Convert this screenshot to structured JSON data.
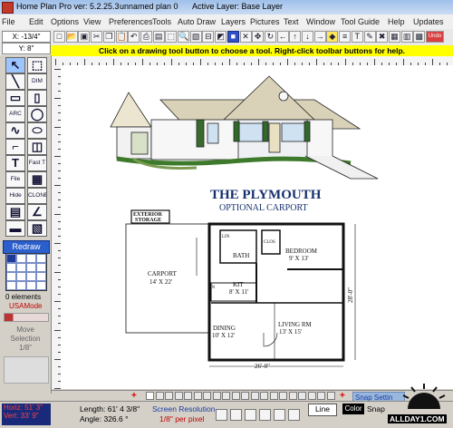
{
  "window": {
    "title": "Home Plan Pro ver: 5.2.25.3",
    "plan_name": "unnamed plan 0",
    "active_layer": "Active Layer: Base Layer"
  },
  "menu": [
    "File",
    "Edit",
    "Options",
    "View",
    "Preferences",
    "Tools",
    "Auto Draw",
    "Layers",
    "Pictures",
    "Text",
    "Window",
    "Tool Guide",
    "Help",
    "Updates"
  ],
  "coords": {
    "x": "X: -13/4\"",
    "y": "Y: 8\""
  },
  "toolbar": {
    "buttons": [
      {
        "name": "new-icon",
        "glyph": "□"
      },
      {
        "name": "open-icon",
        "glyph": "📂"
      },
      {
        "name": "save-icon",
        "glyph": "▣"
      },
      {
        "name": "cut-icon",
        "glyph": "✂"
      },
      {
        "name": "copy-icon",
        "glyph": "❐"
      },
      {
        "name": "paste-icon",
        "glyph": "📋"
      },
      {
        "name": "undo-icon",
        "glyph": "↶"
      },
      {
        "name": "print-icon",
        "glyph": "⎙"
      },
      {
        "name": "save-disk-icon",
        "glyph": "▤"
      },
      {
        "name": "select-icon",
        "glyph": "⬚"
      },
      {
        "name": "zoom-in-icon",
        "glyph": "🔍"
      },
      {
        "name": "zoom-icon",
        "glyph": "▧"
      },
      {
        "name": "zoom-out-icon",
        "glyph": "⊟"
      },
      {
        "name": "mirror-icon",
        "glyph": "◩"
      },
      {
        "name": "blue-square-icon",
        "glyph": "■"
      },
      {
        "name": "cross-icon",
        "glyph": "✕"
      },
      {
        "name": "move-icon",
        "glyph": "✥"
      },
      {
        "name": "rotate-icon",
        "glyph": "↻"
      },
      {
        "name": "left-arrow-icon",
        "glyph": "←"
      },
      {
        "name": "up-arrow-icon",
        "glyph": "↑"
      },
      {
        "name": "down-arrow-icon",
        "glyph": "↓"
      },
      {
        "name": "right-arrow-icon",
        "glyph": "→"
      },
      {
        "name": "yellow-icon",
        "glyph": "◆"
      },
      {
        "name": "align-icon",
        "glyph": "≡"
      },
      {
        "name": "text-icon",
        "glyph": "T"
      },
      {
        "name": "pencil-icon",
        "glyph": "✎"
      },
      {
        "name": "x-close-icon",
        "glyph": "✖"
      },
      {
        "name": "view-icon",
        "glyph": "▦"
      },
      {
        "name": "wall-icon",
        "glyph": "▥"
      },
      {
        "name": "fill-icon",
        "glyph": "▩"
      },
      {
        "name": "undo-badge-icon",
        "glyph": "Undo"
      }
    ],
    "colors": {
      "selected": "#3050c8",
      "highlight": "#ffe65a",
      "undo": "#d84040"
    }
  },
  "help_text": "Click on a drawing tool button to choose a tool.  Right-click toolbar buttons for help.",
  "left_tools": [
    {
      "name": "pointer-tool",
      "label": "↖"
    },
    {
      "name": "select-box-tool",
      "label": "⬚"
    },
    {
      "name": "line-tool",
      "label": "╲"
    },
    {
      "name": "dim-tool",
      "label": "DIM"
    },
    {
      "name": "rect-tool",
      "label": "▭"
    },
    {
      "name": "wall-tool",
      "label": "▯"
    },
    {
      "name": "arc-tool",
      "label": "ARC"
    },
    {
      "name": "circle-tool",
      "label": "◯"
    },
    {
      "name": "curve-tool",
      "label": "∿"
    },
    {
      "name": "ellipse-tool",
      "label": "⬭"
    },
    {
      "name": "door-tool",
      "label": "⌐"
    },
    {
      "name": "window-tool",
      "label": "◫"
    },
    {
      "name": "text-tool",
      "label": "T"
    },
    {
      "name": "fast-text-tool",
      "label": "Fast T"
    },
    {
      "name": "file-tool",
      "label": "File"
    },
    {
      "name": "hatch-tool",
      "label": "▦"
    },
    {
      "name": "hide-tool",
      "label": "Hide"
    },
    {
      "name": "clone-tool",
      "label": "CLONE"
    },
    {
      "name": "stair-tool",
      "label": "▤"
    },
    {
      "name": "angle-tool",
      "label": "∠"
    },
    {
      "name": "erase-tool",
      "label": "▬"
    },
    {
      "name": "fill-tool",
      "label": "▧"
    }
  ],
  "redraw_label": "Redraw",
  "elements_label": "0 elements",
  "mode_label": "USAMode",
  "move_selection": [
    "Move",
    "Selection",
    "1/8\""
  ],
  "plan": {
    "title": "THE PLYMOUTH",
    "subtitle": "OPTIONAL CARPORT",
    "exterior_storage": [
      "EXTERIOR",
      "STORAGE"
    ],
    "carport": [
      "CARPORT",
      "14' X 22'"
    ],
    "bedroom": [
      "BEDROOM",
      "9' X 13'"
    ],
    "bath": "BATH",
    "kit": [
      "KIT",
      "8' X 11'"
    ],
    "dining": [
      "DINING",
      "10' X 12'"
    ],
    "living": [
      "LIVING RM",
      "13' X 15'"
    ],
    "clos": "CLOS",
    "lin": "LIN",
    "dn": "DN",
    "width_dim": "26'-0\"",
    "depth_dim": "28'-0\""
  },
  "scroll_buttons": [
    "+",
    "+"
  ],
  "status": {
    "horiz": "Horiz: 51' 3\"",
    "vert": "Vert: 33' 9\"",
    "length": "Length: 61' 4 3/8\"",
    "angle": "Angle: 326.6 °",
    "resolution_label": "Screen Resolution",
    "resolution_value": "1/8\" per pixel",
    "line_label": "Line",
    "color_label": "Color",
    "snap_label": "Snap",
    "snap_settings": "Snap Settin",
    "watermark": "ALLDAY1.COM"
  }
}
